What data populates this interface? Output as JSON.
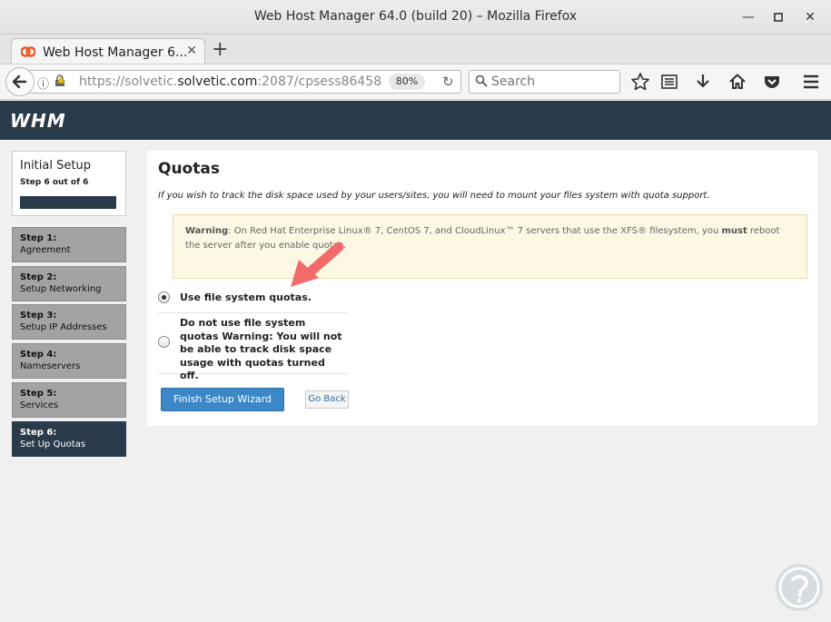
{
  "window": {
    "title": "Web Host Manager 64.0 (build 20) – Mozilla Firefox"
  },
  "tab": {
    "title": "Web Host Manager 6..."
  },
  "navbar": {
    "url_prefix": "https://solvetic.",
    "url_domain": "solvetic.com",
    "url_suffix": ":2087/cpsess86458",
    "zoom": "80%",
    "search_placeholder": "Search"
  },
  "header": {
    "logo": "WHM"
  },
  "sidebar": {
    "heading": "Initial Setup",
    "progress_text": "Step 6 out of 6",
    "progress_fraction": 1.0,
    "steps": [
      {
        "number": "Step 1:",
        "name": "Agreement",
        "active": false
      },
      {
        "number": "Step 2:",
        "name": "Setup Networking",
        "active": false
      },
      {
        "number": "Step 3:",
        "name": "Setup IP Addresses",
        "active": false
      },
      {
        "number": "Step 4:",
        "name": "Nameservers",
        "active": false
      },
      {
        "number": "Step 5:",
        "name": "Services",
        "active": false
      },
      {
        "number": "Step 6:",
        "name": "Set Up Quotas",
        "active": true
      }
    ]
  },
  "main": {
    "title": "Quotas",
    "subtitle": "If you wish to track the disk space used by your users/sites, you will need to mount your files system with quota support.",
    "warning": {
      "label": "Warning",
      "text1": ": On Red Hat Enterprise Linux® 7, CentOS 7, and CloudLinux™ 7 servers that use the XFS® filesystem, you ",
      "must": "must",
      "text2": " reboot the server after you enable quotas."
    },
    "options": [
      {
        "label": "Use file system quotas.",
        "selected": true
      },
      {
        "label": "Do not use file system quotas Warning: You will not be able to track disk space usage with quotas turned off.",
        "selected": false
      }
    ],
    "finish_button": "Finish Setup Wizard",
    "back_button": "Go Back"
  },
  "colors": {
    "header_bg": "#293a4a",
    "primary_button": "#3b87c8",
    "warning_bg": "#fcf8e3",
    "annotation_arrow": "#f26b6b"
  }
}
